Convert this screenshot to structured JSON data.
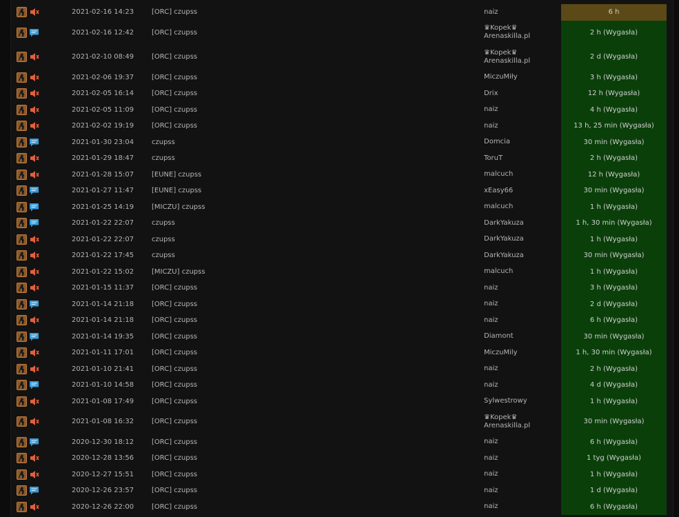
{
  "bans": [
    {
      "date": "2021-02-16 14:23",
      "nick": "[ORC] czupss",
      "admin": "naiz",
      "duration": "6 h",
      "type": "voice",
      "active": true
    },
    {
      "date": "2021-02-16 12:42",
      "nick": "[ORC] czupss",
      "admin": "♛Kopek♛ Arenaskilla.pl",
      "duration": "2 h (Wygasła)",
      "type": "chat"
    },
    {
      "date": "2021-02-10 08:49",
      "nick": "[ORC] czupss",
      "admin": "♛Kopek♛ Arenaskilla.pl",
      "duration": "2 d (Wygasła)",
      "type": "voice"
    },
    {
      "date": "2021-02-06 19:37",
      "nick": "[ORC] czupss",
      "admin": "MiczuMiły",
      "duration": "3 h (Wygasła)",
      "type": "voice"
    },
    {
      "date": "2021-02-05 16:14",
      "nick": "[ORC] czupss",
      "admin": "Drix",
      "duration": "12 h (Wygasła)",
      "type": "voice"
    },
    {
      "date": "2021-02-05 11:09",
      "nick": "[ORC] czupss",
      "admin": "naiz",
      "duration": "4 h (Wygasła)",
      "type": "voice"
    },
    {
      "date": "2021-02-02 19:19",
      "nick": "[ORC] czupss",
      "admin": "naiz",
      "duration": "13 h, 25 min (Wygasła)",
      "type": "voice"
    },
    {
      "date": "2021-01-30 23:04",
      "nick": "czupss",
      "admin": "Domcia",
      "duration": "30 min (Wygasła)",
      "type": "chat"
    },
    {
      "date": "2021-01-29 18:47",
      "nick": "czupss",
      "admin": "ToruT",
      "duration": "2 h (Wygasła)",
      "type": "voice"
    },
    {
      "date": "2021-01-28 15:07",
      "nick": "[EUNE] czupss",
      "admin": "malcuch",
      "duration": "12 h (Wygasła)",
      "type": "voice"
    },
    {
      "date": "2021-01-27 11:47",
      "nick": "[EUNE] czupss",
      "admin": "xEasy66",
      "duration": "30 min (Wygasła)",
      "type": "chat"
    },
    {
      "date": "2021-01-25 14:19",
      "nick": "[MICZU] czupss",
      "admin": "malcuch",
      "duration": "1 h (Wygasła)",
      "type": "chat"
    },
    {
      "date": "2021-01-22 22:07",
      "nick": "czupss",
      "admin": "DarkYakuza",
      "duration": "1 h, 30 min (Wygasła)",
      "type": "chat"
    },
    {
      "date": "2021-01-22 22:07",
      "nick": "czupss",
      "admin": "DarkYakuza",
      "duration": "1 h (Wygasła)",
      "type": "voice"
    },
    {
      "date": "2021-01-22 17:45",
      "nick": "czupss",
      "admin": "DarkYakuza",
      "duration": "30 min (Wygasła)",
      "type": "voice"
    },
    {
      "date": "2021-01-22 15:02",
      "nick": "[MICZU] czupss",
      "admin": "malcuch",
      "duration": "1 h (Wygasła)",
      "type": "voice"
    },
    {
      "date": "2021-01-15 11:37",
      "nick": "[ORC] czupss",
      "admin": "naiz",
      "duration": "3 h (Wygasła)",
      "type": "voice"
    },
    {
      "date": "2021-01-14 21:18",
      "nick": "[ORC] czupss",
      "admin": "naiz",
      "duration": "2 d (Wygasła)",
      "type": "chat"
    },
    {
      "date": "2021-01-14 21:18",
      "nick": "[ORC] czupss",
      "admin": "naiz",
      "duration": "6 h (Wygasła)",
      "type": "voice"
    },
    {
      "date": "2021-01-14 19:35",
      "nick": "[ORC] czupss",
      "admin": "Diamont",
      "duration": "30 min (Wygasła)",
      "type": "chat"
    },
    {
      "date": "2021-01-11 17:01",
      "nick": "[ORC] czupss",
      "admin": "MiczuMily",
      "duration": "1 h, 30 min (Wygasła)",
      "type": "voice"
    },
    {
      "date": "2021-01-10 21:41",
      "nick": "[ORC] czupss",
      "admin": "naiz",
      "duration": "2 h (Wygasła)",
      "type": "voice"
    },
    {
      "date": "2021-01-10 14:58",
      "nick": "[ORC] czupss",
      "admin": "naiz",
      "duration": "4 d (Wygasła)",
      "type": "chat"
    },
    {
      "date": "2021-01-08 17:49",
      "nick": "[ORC] czupss",
      "admin": "Sylwestrowy",
      "duration": "1 h (Wygasła)",
      "type": "voice"
    },
    {
      "date": "2021-01-08 16:32",
      "nick": "[ORC] czupss",
      "admin": "♛Kopek♛ Arenaskilla.pl",
      "duration": "30 min (Wygasła)",
      "type": "voice"
    },
    {
      "date": "2020-12-30 18:12",
      "nick": "[ORC] czupss",
      "admin": "naiz",
      "duration": "6 h (Wygasła)",
      "type": "chat"
    },
    {
      "date": "2020-12-28 13:56",
      "nick": "[ORC] czupss",
      "admin": "naiz",
      "duration": "1 tyg (Wygasła)",
      "type": "voice"
    },
    {
      "date": "2020-12-27 15:51",
      "nick": "[ORC] czupss",
      "admin": "naiz",
      "duration": "1 h (Wygasła)",
      "type": "voice"
    },
    {
      "date": "2020-12-26 23:57",
      "nick": "[ORC] czupss",
      "admin": "naiz",
      "duration": "1 d (Wygasła)",
      "type": "chat"
    },
    {
      "date": "2020-12-26 22:00",
      "nick": "[ORC] czupss",
      "admin": "naiz",
      "duration": "6 h (Wygasła)",
      "type": "voice"
    }
  ],
  "icons": {
    "game": "csgo-game-icon",
    "voice": "speaker-mute-icon",
    "chat": "chat-bubble-icon"
  },
  "colors": {
    "active": "#5b4a17",
    "expired": "#0a3f0a",
    "background": "#121212",
    "text": "#b5b5b5"
  }
}
